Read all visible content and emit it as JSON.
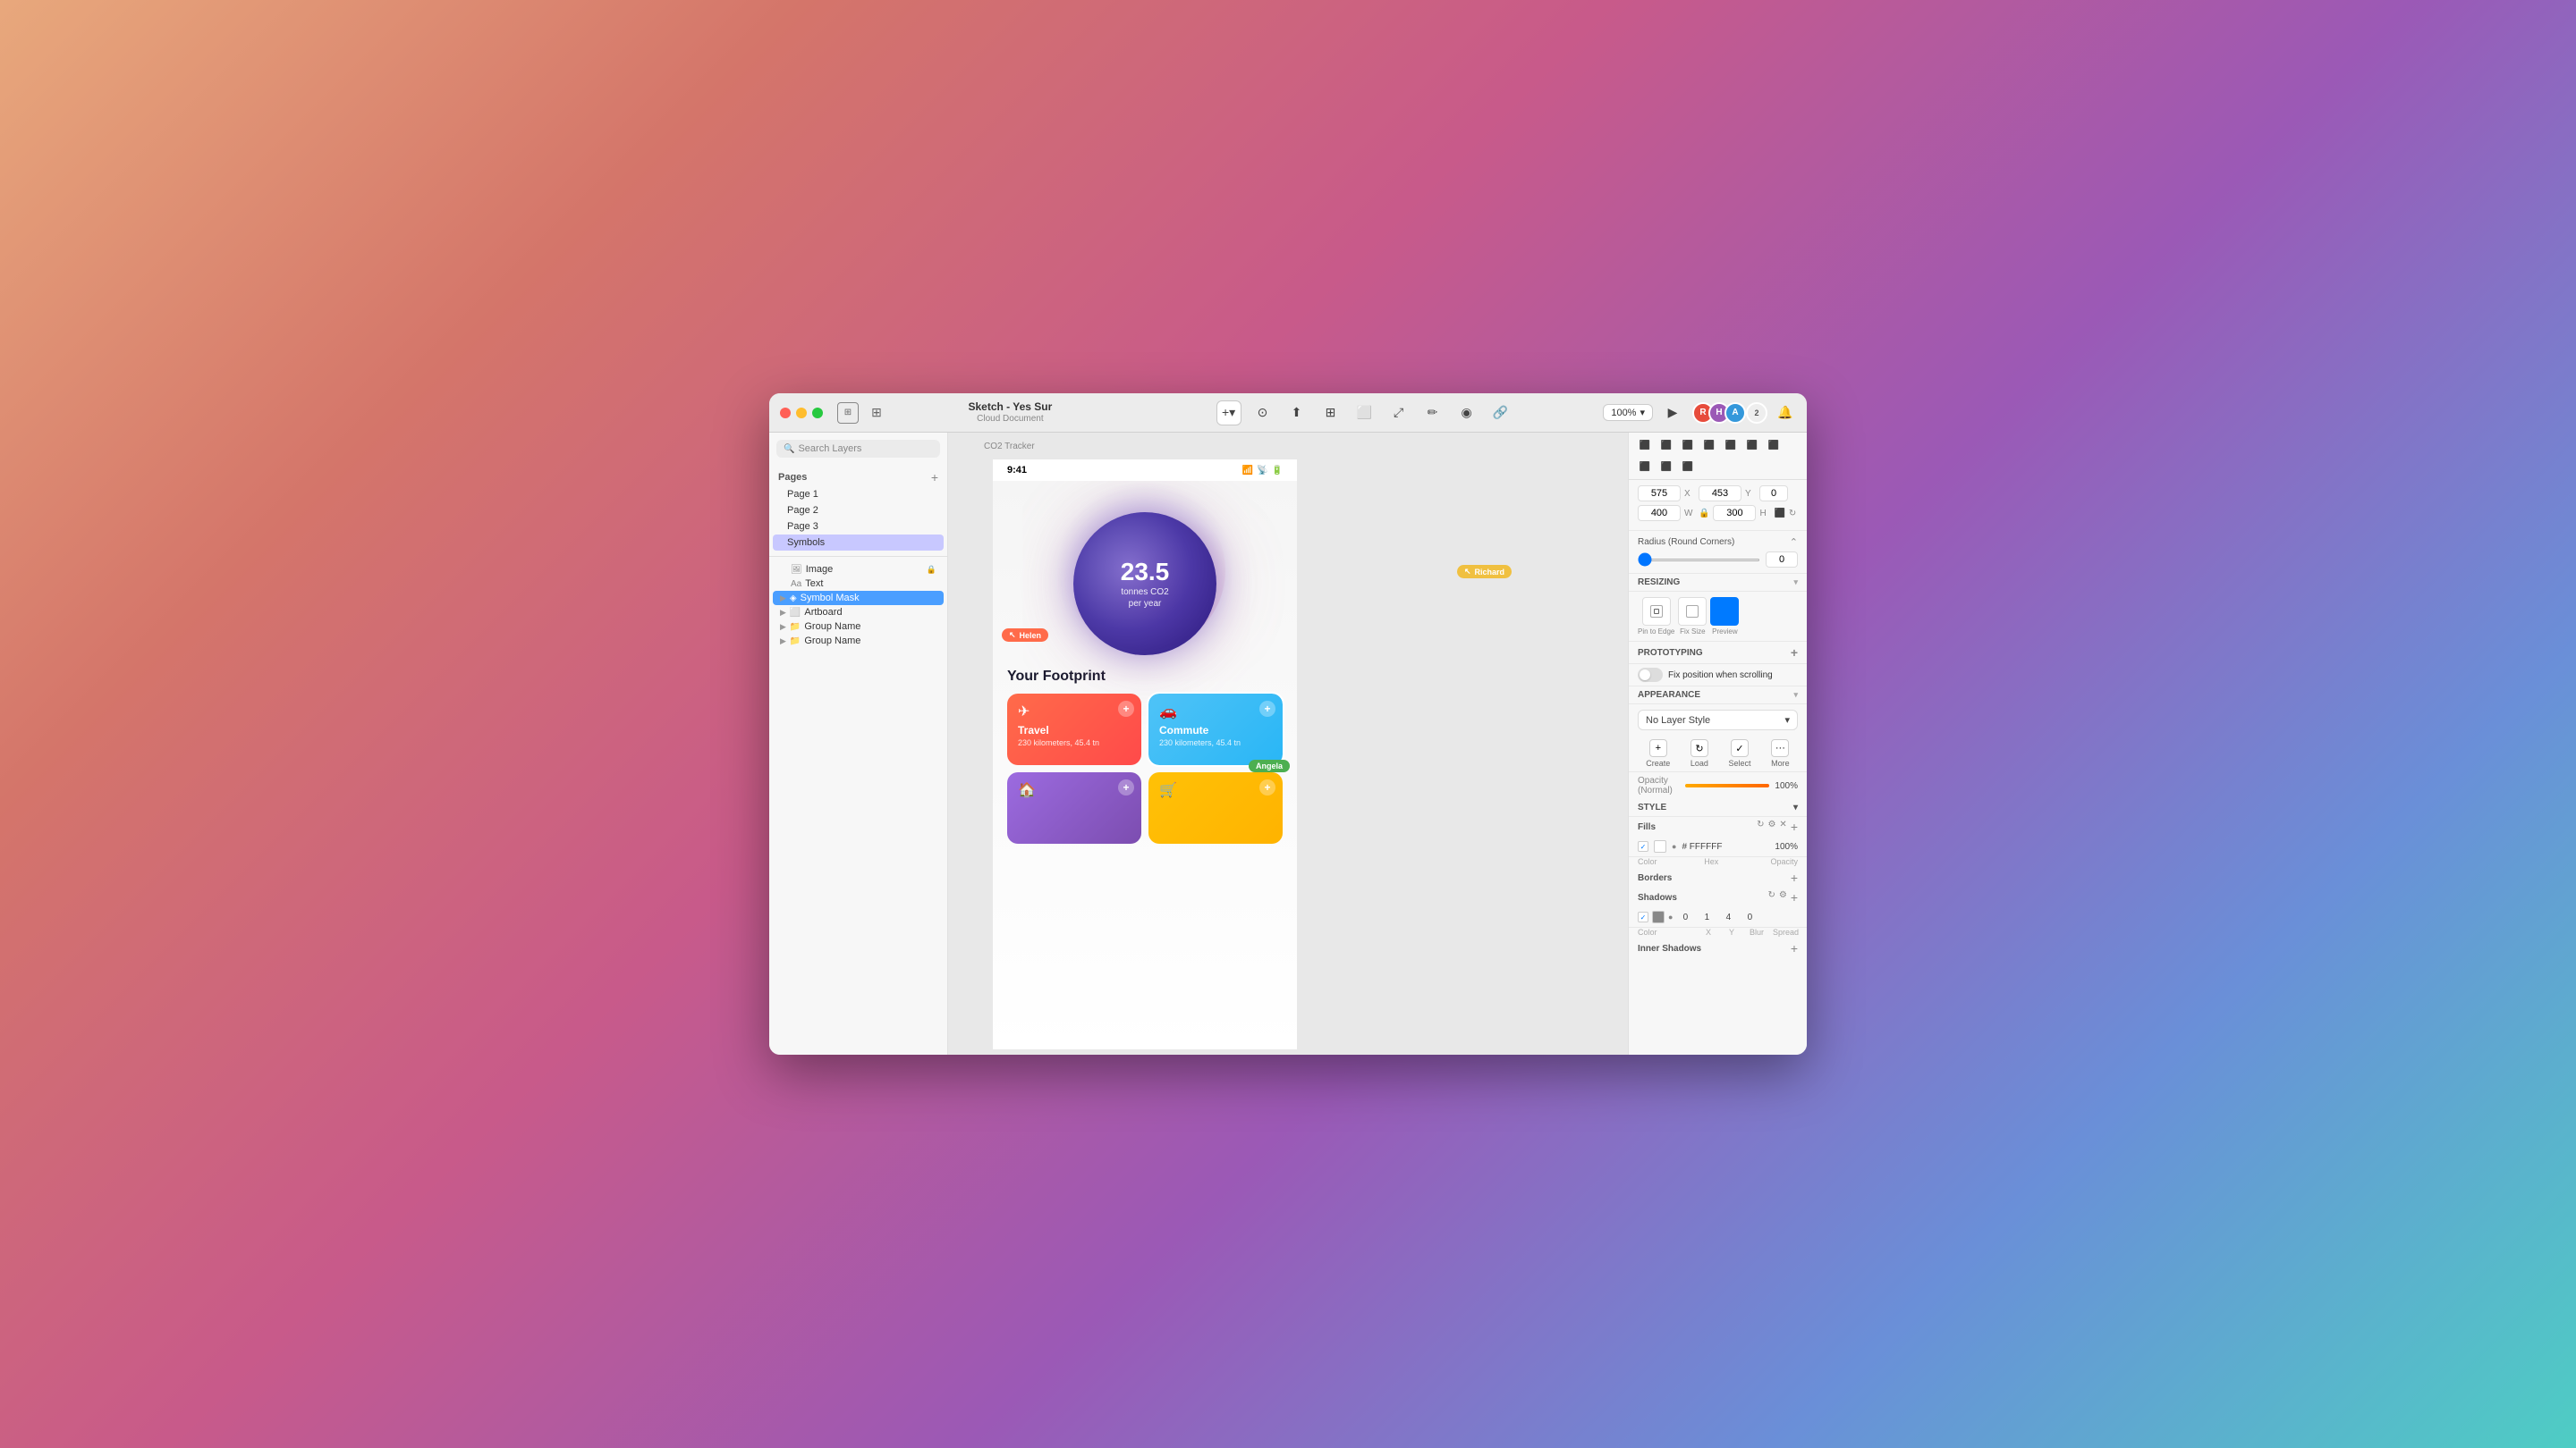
{
  "window": {
    "title": "Sketch - Yes Sur",
    "subtitle": "Cloud Document"
  },
  "toolbar": {
    "zoom": "100%",
    "zoom_chevron": "▾",
    "plus_label": "+",
    "avatars": [
      "R",
      "H",
      "A"
    ],
    "avatar_count": "2"
  },
  "sidebar": {
    "search_placeholder": "Search Layers",
    "pages_label": "Pages",
    "pages": [
      {
        "label": "Page 1"
      },
      {
        "label": "Page 2"
      },
      {
        "label": "Page 3"
      },
      {
        "label": "Symbols",
        "active": true
      }
    ],
    "layers": [
      {
        "label": "Image",
        "type": "image",
        "indent": 1,
        "locked": true
      },
      {
        "label": "Text",
        "type": "text",
        "indent": 1
      },
      {
        "label": "Symbol Mask",
        "type": "symbol",
        "indent": 0,
        "selected": true
      },
      {
        "label": "Artboard",
        "type": "artboard",
        "indent": 0
      },
      {
        "label": "Group Name",
        "type": "group",
        "indent": 0
      },
      {
        "label": "Group Name",
        "type": "group",
        "indent": 0
      }
    ]
  },
  "canvas": {
    "label": "CO2 Tracker",
    "artboard": {
      "status_time": "9:41",
      "circle_number": "23.5",
      "circle_label_1": "tonnes CO2",
      "circle_label_2": "per year",
      "footprint_title": "Your Footprint",
      "card1_title": "Travel",
      "card1_sub": "230 kilometers, 45.4 tn",
      "card1_icon": "✈",
      "card2_title": "Commute",
      "card2_sub": "230 kilometers, 45.4 tn",
      "card2_icon": "🚗",
      "card3_icon": "🏠",
      "card4_icon": "🛒",
      "helen_tag": "Helen",
      "richard_tag": "Richard",
      "angela_tag": "Angela"
    }
  },
  "right_panel": {
    "x_label": "X",
    "y_label": "Y",
    "w_label": "W",
    "h_label": "H",
    "x_val": "575",
    "y_val": "453",
    "y_num": "0",
    "w_val": "400",
    "h_val": "300",
    "radius_label": "Radius (Round Corners)",
    "radius_val": "0",
    "resizing_label": "RESIZING",
    "resize_btn1": "Pin to Edge",
    "resize_btn2": "Fix Size",
    "resize_btn3": "Preview",
    "prototyping_label": "PROTOTYPING",
    "proto_fix_label": "Fix position when scrolling",
    "appearance_label": "APPEARANCE",
    "no_layer_style": "No Layer Style",
    "create_label": "Create",
    "load_label": "Load",
    "select_label": "Select",
    "more_label": "More",
    "opacity_label": "Opacity (Normal)",
    "opacity_val": "100%",
    "style_label": "STYLE",
    "fills_label": "Fills",
    "fill_hex": "FFFFFF",
    "fill_opacity": "100%",
    "fill_color_label": "Color",
    "fill_hex_label": "Hex",
    "fill_opacity_label": "Opacity",
    "borders_label": "Borders",
    "shadows_label": "Shadows",
    "shadow_x": "0",
    "shadow_y": "1",
    "shadow_blur": "4",
    "shadow_spread": "0",
    "shadow_color_label": "Color",
    "shadow_x_label": "X",
    "shadow_y_label": "Y",
    "shadow_blur_label": "Blur",
    "shadow_spread_label": "Spread",
    "inner_shadows_label": "Inner Shadows"
  }
}
